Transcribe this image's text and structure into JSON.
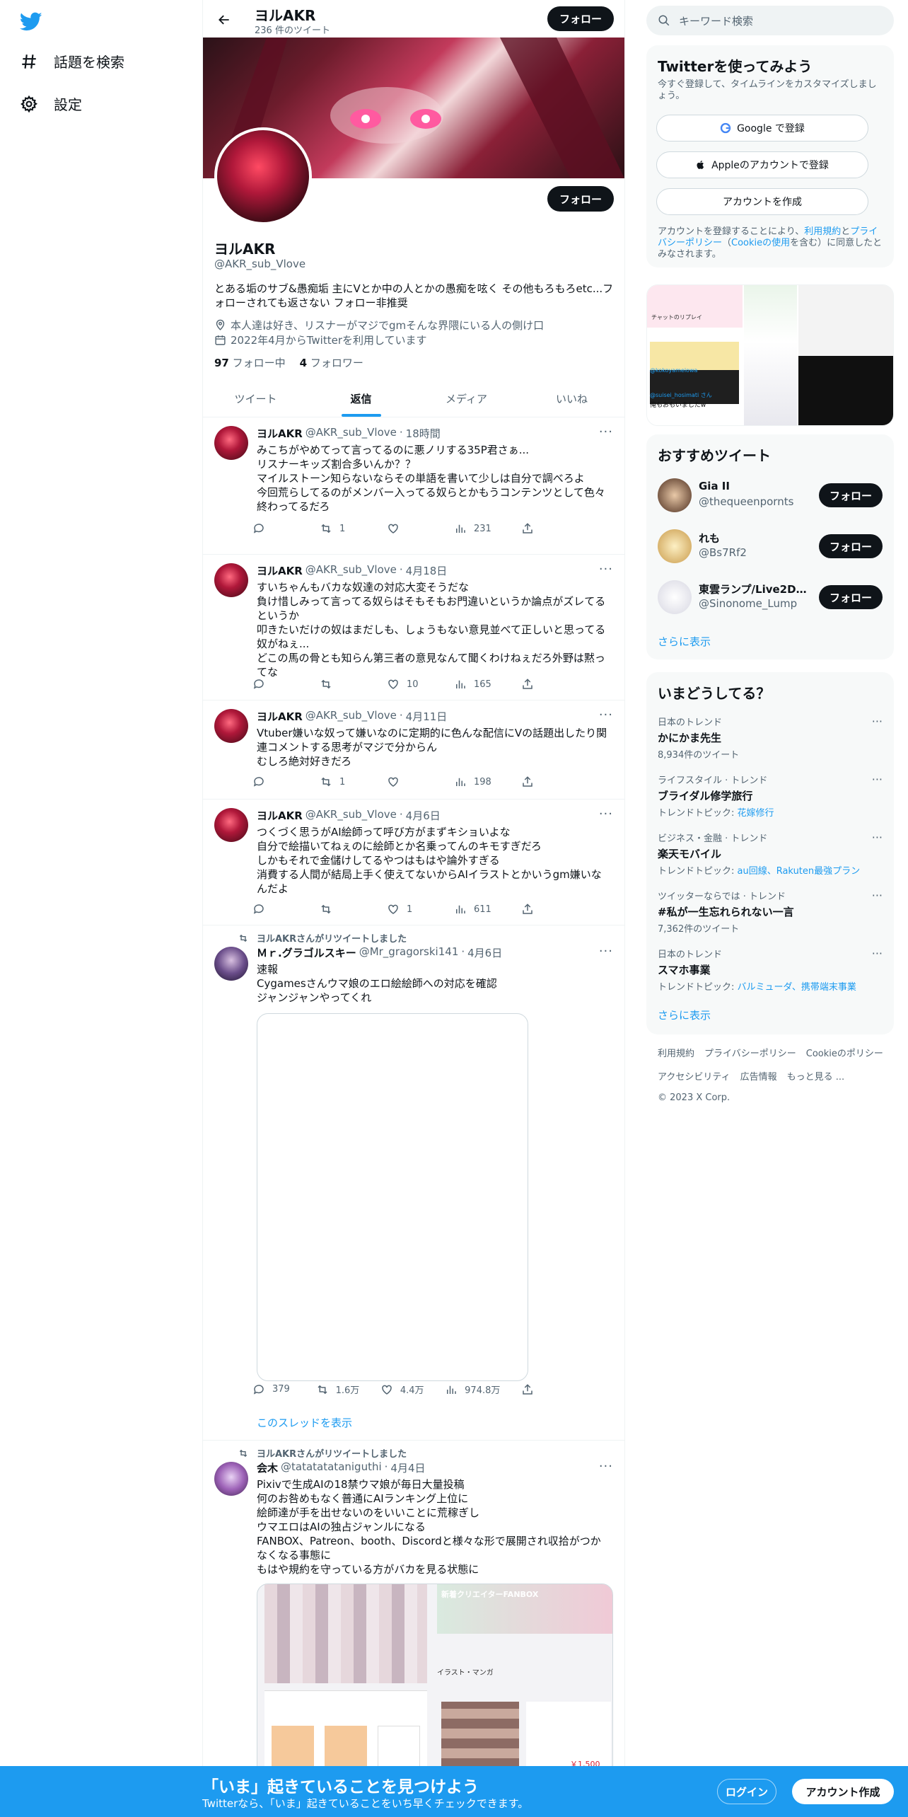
{
  "nav": {
    "explore": "話題を検索",
    "settings": "設定"
  },
  "header": {
    "name": "ヨルAKR",
    "tweet_count": "236 件のツイート",
    "follow": "フォロー"
  },
  "profile": {
    "name": "ヨルAKR",
    "handle": "@AKR_sub_Vlove",
    "follow": "フォロー",
    "bio": "とある垢のサブ&愚痴垢 主にVとか中の人とかの愚痴を呟く その他もろもろetc...フォローされても返さない フォロー非推奨",
    "location": "本人達は好き、リスナーがマジでgmそんな界隈にいる人の側け口",
    "joined": "2022年4月からTwitterを利用しています",
    "following_count": "97",
    "following_label": "フォロー中",
    "followers_count": "4",
    "followers_label": "フォロワー"
  },
  "tabs": [
    "ツイート",
    "返信",
    "メディア",
    "いいね"
  ],
  "tweets": [
    {
      "name": "ヨルAKR",
      "handle": "@AKR_sub_Vlove",
      "time": "18時間",
      "text": "みこちがやめてって言ってるのに悪ノリする35P君さぁ...\nリスナーキッズ割合多いんか？？\nマイルストーン知らないならその単語を書いて少しは自分で調べろよ\n今回荒らしてるのがメンバー入ってる奴らとかもうコンテンツとして色々終わってるだろ",
      "replies": "",
      "retweets": "1",
      "likes": "",
      "views": "231"
    },
    {
      "name": "ヨルAKR",
      "handle": "@AKR_sub_Vlove",
      "time": "4月18日",
      "text": "すいちゃんもバカな奴達の対応大変そうだな\n負け惜しみって言ってる奴らはそもそもお門違いというか論点がズレてるというか\n叩きたいだけの奴はまだしも、しょうもない意見並べて正しいと思ってる奴がねぇ...\nどこの馬の骨とも知らん第三者の意見なんて聞くわけねぇだろ外野は黙ってな",
      "replies": "",
      "retweets": "",
      "likes": "10",
      "views": "165"
    },
    {
      "name": "ヨルAKR",
      "handle": "@AKR_sub_Vlove",
      "time": "4月11日",
      "text": "Vtuber嫌いな奴って嫌いなのに定期的に色んな配信にVの話題出したり関連コメントする思考がマジで分からん\nむしろ絶対好きだろ",
      "replies": "",
      "retweets": "1",
      "likes": "",
      "views": "198"
    },
    {
      "name": "ヨルAKR",
      "handle": "@AKR_sub_Vlove",
      "time": "4月6日",
      "text": "つくづく思うがAI絵師って呼び方がまずキショいよな\n自分で絵描いてねぇのに絵師とか名乗ってんのキモすぎだろ\nしかもそれで金儲けしてるやつはもはや論外すぎる\n消費する人間が結局上手く使えてないからAIイラストとかいうgm嫌いなんだよ",
      "replies": "",
      "retweets": "",
      "likes": "1",
      "views": "611"
    },
    {
      "rt_by": "ヨルAKRさんがリツイートしました",
      "name": "Ｍｒ.グラゴルスキー",
      "handle": "@Mr_gragorski141",
      "time": "4月6日",
      "text": "速報\nCygamesさんウマ娘のエロ絵絵師への対応を確認\nジャンジャンやってくれ",
      "replies": "379",
      "retweets": "1.6万",
      "likes": "4.4万",
      "views": "974.8万",
      "show_thread": "このスレッドを表示"
    },
    {
      "rt_by": "ヨルAKRさんがリツイートしました",
      "name": "会木",
      "handle": "@tatatatataniguthi",
      "time": "4月4日",
      "text": "Pixivで生成AIの18禁ウマ娘が毎日大量投稿\n何のお咎めもなく普通にAIランキング上位に\n絵師達が手を出せないのをいいことに荒稼ぎし\nウマエロはAIの独占ジャンルになる\nFANBOX、Patreon、booth、Discordと様々な形で展開され収拾がつかなくなる事態に\nもはや規約を守っている方がバカを見る状態に",
      "media_labels": [
        "新着クリエイターFANBOX",
        "イラスト・マンガ"
      ],
      "price": "￥1,500"
    }
  ],
  "right": {
    "search_placeholder": "キーワード検索",
    "signup": {
      "title": "Twitterを使ってみよう",
      "subtitle": "今すぐ登録して、タイムラインをカスタマイズしましょう。",
      "google": "Google で登録",
      "apple": "Appleのアカウントで登録",
      "create": "アカウントを作成",
      "terms_prefix": "アカウントを登録することにより、",
      "terms_link": "利用規約",
      "terms_and": "と",
      "privacy_link": "プライバシーポリシー",
      "cookie_open": "（",
      "cookie_link": "Cookieの使用",
      "terms_suffix": "を含む）に同意したとみなされます。"
    },
    "media_text": [
      "チャットのリプレイ",
      "@kokoyameiowa",
      "@suisei_hosimati さん",
      "俺もおもいましたw"
    ],
    "recommended": {
      "title": "おすすめツイート",
      "users": [
        {
          "name": "Gia II",
          "handle": "@thequeenpornts",
          "follow": "フォロー"
        },
        {
          "name": "れも",
          "handle": "@Bs7Rf2",
          "follow": "フォロー"
        },
        {
          "name": "東雲ランプ/Live2Dデ...",
          "handle": "@Sinonome_Lump",
          "follow": "フォロー"
        }
      ],
      "more": "さらに表示"
    },
    "trends": {
      "title": "いまどうしてる？",
      "items": [
        {
          "context": "日本のトレンド",
          "name": "かにかま先生",
          "meta": "8,934件のツイート",
          "meta_link": ""
        },
        {
          "context": "ライフスタイル · トレンド",
          "name": "ブライダル修学旅行",
          "meta": "トレンドトピック: ",
          "meta_link": "花嫁修行"
        },
        {
          "context": "ビジネス・金融 · トレンド",
          "name": "楽天モバイル",
          "meta": "トレンドトピック: ",
          "meta_link": "au回線、Rakuten最強プラン"
        },
        {
          "context": "ツイッターならでは · トレンド",
          "name": "#私が一生忘れられない一言",
          "meta": "7,362件のツイート",
          "meta_link": ""
        },
        {
          "context": "日本のトレンド",
          "name": "スマホ事業",
          "meta": "トレンドトピック: ",
          "meta_link": "バルミューダ、携帯端末事業"
        }
      ],
      "more": "さらに表示"
    },
    "footer": [
      "利用規約",
      "プライバシーポリシー",
      "Cookieのポリシー",
      "アクセシビリティ",
      "広告情報",
      "もっと見る ...",
      "© 2023 X Corp."
    ]
  },
  "bottom": {
    "title": "「いま」起きていることを見つけよう",
    "subtitle": "Twitterなら、「いま」起きていることをいち早くチェックできます。",
    "login": "ログイン",
    "signup": "アカウント作成"
  },
  "colors": {
    "accent": "#1d9bf0",
    "text": "#0f1419",
    "muted": "#536471",
    "border": "#eff3f4"
  }
}
